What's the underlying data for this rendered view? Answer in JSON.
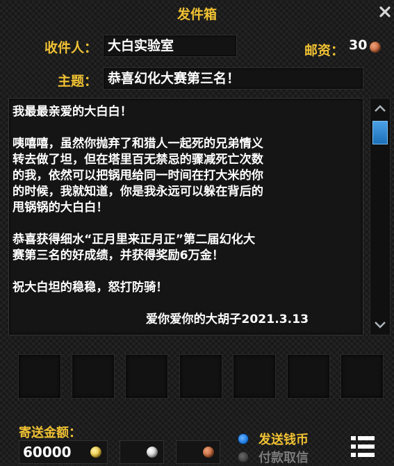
{
  "window": {
    "title": "发件箱"
  },
  "recipient": {
    "label": "收件人：",
    "value": "大白实验室"
  },
  "postage": {
    "label": "邮资：",
    "value": "30",
    "coin_icon": "copper-coin-icon"
  },
  "subject": {
    "label": "主题：",
    "value": "恭喜幻化大赛第三名！"
  },
  "letter": {
    "paragraphs": [
      "我最最亲爱的大白白！",
      "咦嘻嘻，虽然你抛弃了和猎人一起死的兄弟情义\n转去做了坦，但在塔里百无禁忌的骤减死亡次数\n的我，依然可以把锅甩给同一时间在打大米的你\n的时候，我就知道，你是我永远可以躲在背后的\n甩锅锅的大白白！",
      "恭喜获得细水“正月里来正月正”第二届幻化大\n赛第三名的好成绩，并获得奖励6万金！",
      "祝大白坦的稳稳，怒打防骑！"
    ],
    "signature": "爱你爱你的大胡子2021.3.13"
  },
  "attachments": {
    "slot_count": 7
  },
  "send_money": {
    "label": "寄送金额：",
    "gold": "60000",
    "silver": "",
    "copper": ""
  },
  "mode": {
    "send_coin_label": "发送钱币",
    "cod_label": "付款取信",
    "selected": "send_coin"
  },
  "colors": {
    "label_gold": "#f1c233",
    "radio_selected": "#1e7ce0",
    "gold_coin": "#e8c23a",
    "silver_coin": "#c8c8c8",
    "copper_coin": "#c0643a"
  }
}
